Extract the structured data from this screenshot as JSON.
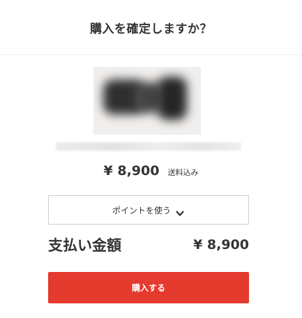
{
  "dialog": {
    "title": "購入を確定しますか？"
  },
  "product": {
    "image_icon": "blurred-product-image",
    "name": "",
    "price": "¥ 8,900",
    "shipping_note": "送料込み"
  },
  "points": {
    "label": "ポイントを使う",
    "icon": "chevron-down-icon"
  },
  "payment": {
    "total_label": "支払い金額",
    "total_value": "¥ 8,900"
  },
  "actions": {
    "purchase_label": "購入する"
  },
  "colors": {
    "accent": "#e53a2e",
    "text": "#333333"
  }
}
